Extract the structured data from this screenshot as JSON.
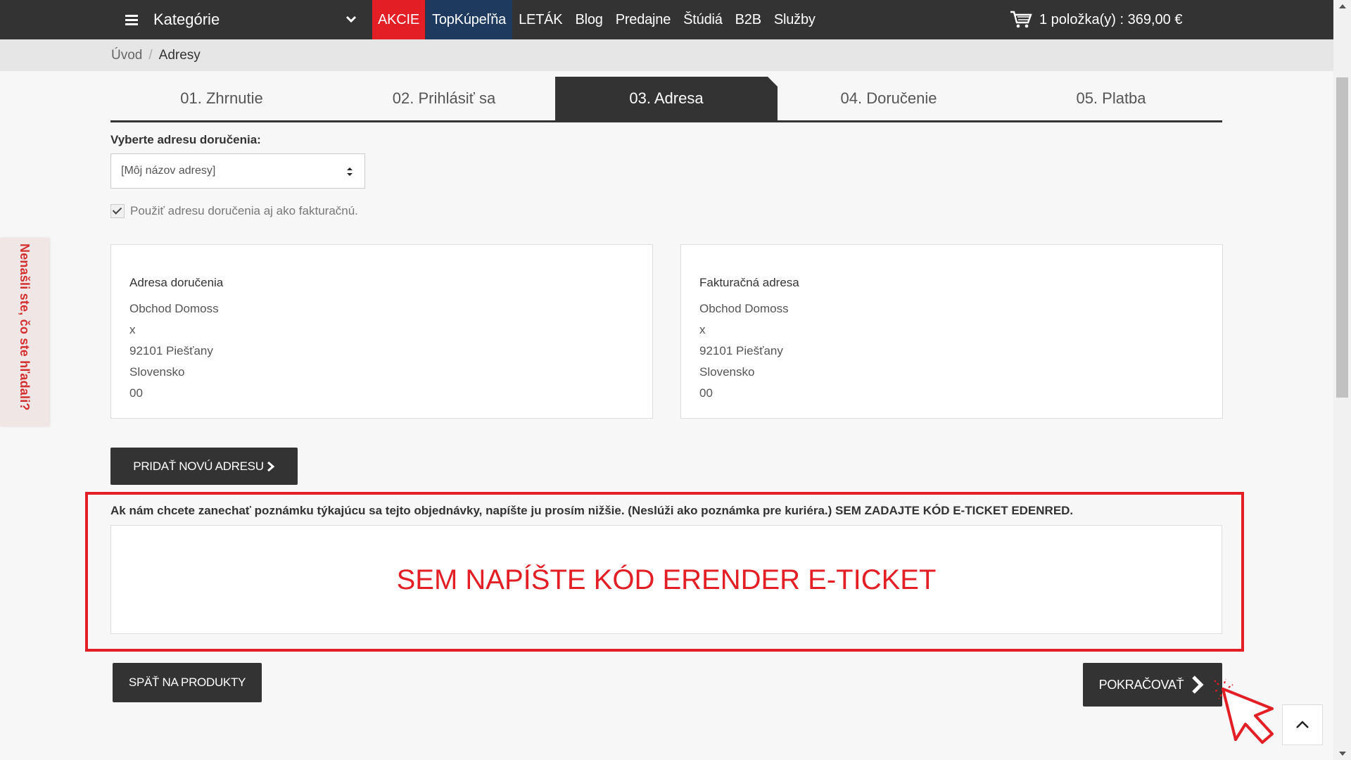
{
  "topnav": {
    "category_label": "Kategórie",
    "items": [
      {
        "label": "AKCIE"
      },
      {
        "label": "TopKúpeľňa"
      },
      {
        "label": "LETÁK"
      },
      {
        "label": "Blog"
      },
      {
        "label": "Predajne"
      },
      {
        "label": "Štúdiá"
      },
      {
        "label": "B2B"
      },
      {
        "label": "Služby"
      }
    ],
    "cart": "1 položka(y) : 369,00 €"
  },
  "breadcrumb": {
    "home": "Úvod",
    "separator": "/",
    "current": "Adresy"
  },
  "sidetab": "Nenašli ste, čo ste hľadali?",
  "steps": [
    {
      "label": "01. Zhrnutie"
    },
    {
      "label": "02. Prihlásiť sa"
    },
    {
      "label": "03. Adresa"
    },
    {
      "label": "04. Doručenie"
    },
    {
      "label": "05. Platba"
    }
  ],
  "address_select": {
    "label": "Vyberte adresu doručenia:",
    "value": "[Môj názov adresy]"
  },
  "same_billing": {
    "label": "Použiť adresu doručenia aj ako fakturačnú.",
    "checked": true
  },
  "delivery": {
    "title": "Adresa doručenia",
    "lines": [
      "Obchod Domoss",
      "x",
      "92101 Piešťany",
      "Slovensko",
      "00"
    ]
  },
  "billing": {
    "title": "Fakturačná adresa",
    "lines": [
      "Obchod Domoss",
      "x",
      "92101 Piešťany",
      "Slovensko",
      "00"
    ]
  },
  "add_address_button": "PRIDAŤ NOVÚ ADRESU",
  "note": {
    "label": "Ak nám chcete zanechať poznámku týkajúcu sa tejto objednávky, napíšte ju prosím nižšie. (Neslúži ako poznámka pre kuriéra.) SEM ZADAJTE KÓD E-TICKET EDENRED.",
    "overlay": "SEM NAPÍŠTE KÓD ERENDER E-TICKET"
  },
  "back_button": "SPÄŤ NA PRODUKTY",
  "continue_button": "POKRAČOVAŤ",
  "colors": {
    "accent_red": "#e31e24",
    "dark": "#333333",
    "topkupelna_blue": "#1e3a5f"
  }
}
